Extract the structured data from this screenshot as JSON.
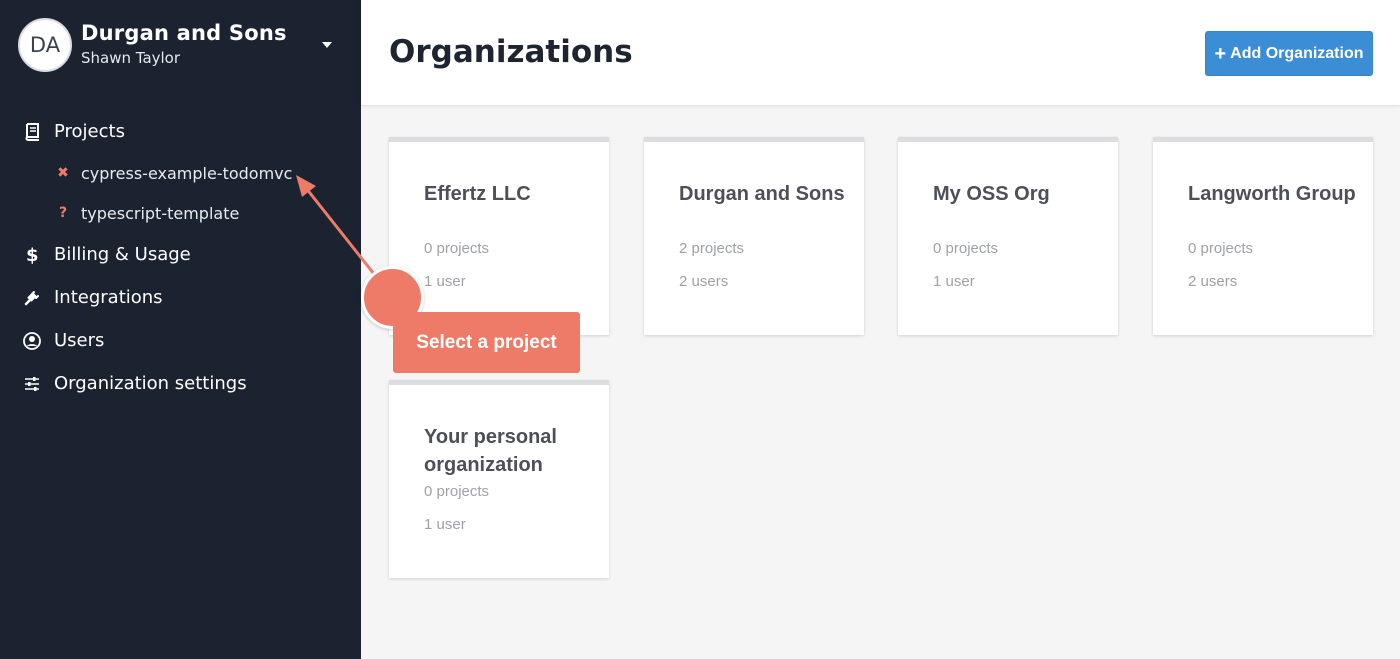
{
  "sidebar": {
    "avatar_initials": "DA",
    "org_name": "Durgan and Sons",
    "user_name": "Shawn Taylor",
    "nav": {
      "projects": "Projects",
      "project_items": [
        {
          "label": "cypress-example-todomvc",
          "status_icon": "x-icon",
          "status_glyph": "✖"
        },
        {
          "label": "typescript-template",
          "status_icon": "question-icon",
          "status_glyph": "?"
        }
      ],
      "billing": "Billing & Usage",
      "integrations": "Integrations",
      "users": "Users",
      "org_settings": "Organization settings"
    }
  },
  "header": {
    "title": "Organizations",
    "add_button": "Add Organization"
  },
  "organizations": [
    {
      "name": "Effertz LLC",
      "projects": "0 projects",
      "users": "1 user"
    },
    {
      "name": "Durgan and Sons",
      "projects": "2 projects",
      "users": "2 users"
    },
    {
      "name": "My OSS Org",
      "projects": "0 projects",
      "users": "1 user"
    },
    {
      "name": "Langworth Group",
      "projects": "0 projects",
      "users": "2 users"
    },
    {
      "name": "Your personal organization",
      "projects": "0 projects",
      "users": "1 user"
    }
  ],
  "annotation": {
    "callout": "Select a project"
  },
  "colors": {
    "sidebar_bg": "#1b2331",
    "accent_blue": "#3b8ed6",
    "annotation_coral": "#ee7b67"
  }
}
